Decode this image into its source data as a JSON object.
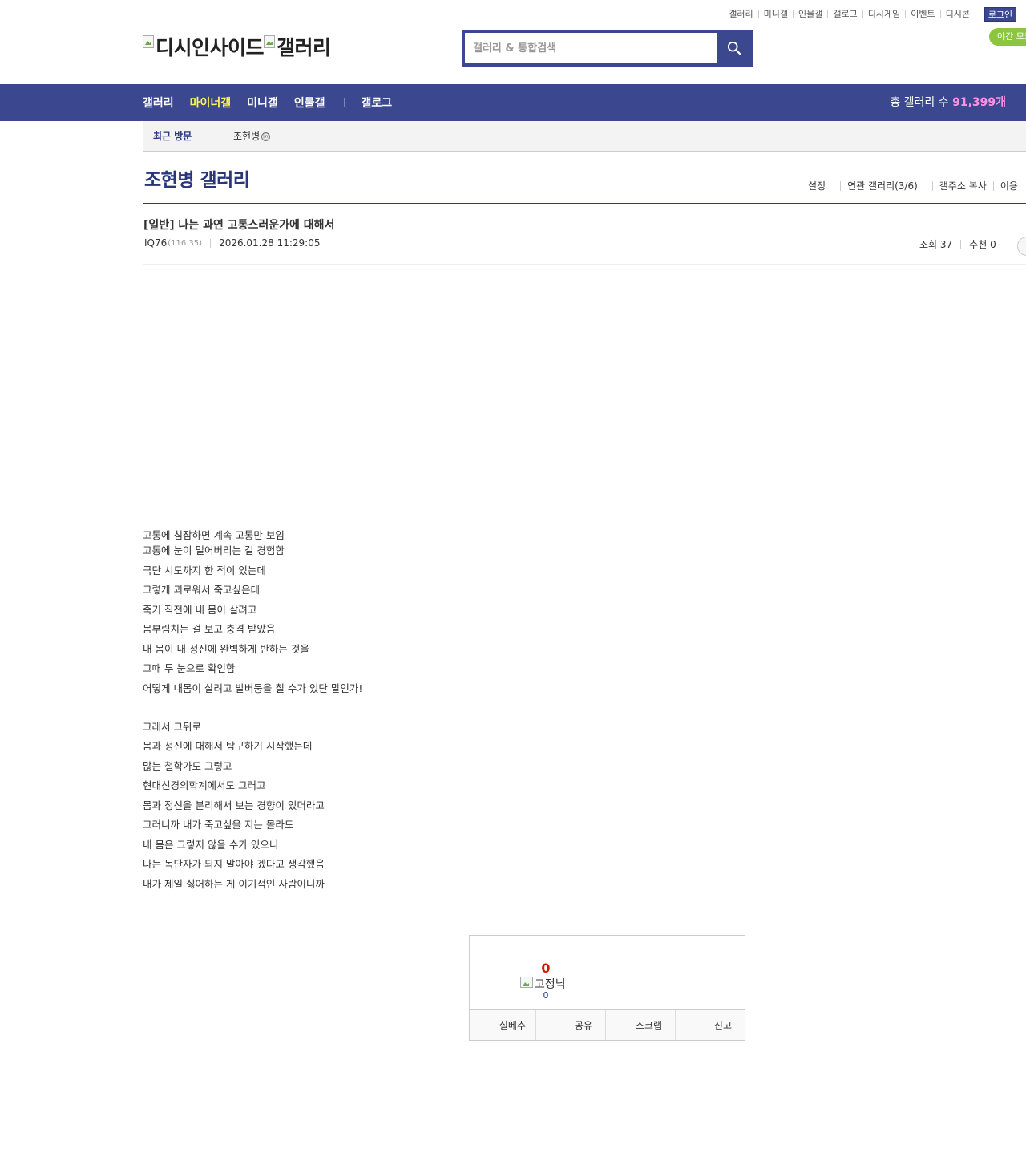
{
  "top_util": {
    "links": [
      "갤러리",
      "미니갤",
      "인물갤",
      "갤로그",
      "디시게임",
      "이벤트",
      "디시콘"
    ],
    "login": "로그인",
    "night_mode": "야간 모드"
  },
  "logo": {
    "site_alt": "디시인사이드",
    "gallery_alt": "갤러리"
  },
  "search": {
    "placeholder": "갤러리 & 통합검색"
  },
  "nav": {
    "items": [
      "갤러리",
      "마이너갤",
      "미니갤",
      "인물갤"
    ],
    "gallog": "갤로그",
    "count_label": "총 갤러리 수 ",
    "count_value": "91,399개"
  },
  "recent": {
    "label": "최근 방문",
    "items": [
      "조현병"
    ],
    "minor_icon": "ⓜ"
  },
  "gallery": {
    "title": "조현병 갤러리",
    "links": [
      "설정",
      "연관 갤러리(3/6)",
      "갤주소 복사",
      "이용"
    ]
  },
  "post": {
    "title": "[일반] 나는 과연 고통스러운가에 대해서",
    "author": "IQ76",
    "author_ip": "(116.35)",
    "date": "2026.01.28 11:29:05",
    "views": "조회 37",
    "recommends": "추천 0"
  },
  "body": {
    "lines_a": [
      "고통에 침잠하면 계속 고통만 보임",
      "고통에 눈이 멀어버리는 걸 경험함",
      "극단 시도까지 한 적이 있는데",
      "그렇게 괴로워서 죽고싶은데",
      "죽기 직전에 내 몸이 살려고",
      "몸부림치는 걸 보고 충격 받았음",
      "내 몸이 내 정신에 완벽하게 반하는 것을",
      "그때 두 눈으로 확인함",
      "어떻게 내몸이 살려고 발버둥을 칠 수가 있단 말인가!"
    ],
    "lines_b": [
      "그래서 그뒤로",
      "몸과 정신에 대해서 탐구하기 시작했는데",
      "많는 철학가도 그렇고",
      "현대신경의학계에서도 그러고",
      "몸과 정신을 분리해서 보는 경향이 있더라고",
      "그러니까 내가 죽고싶을 지는 몰라도",
      "내 몸은 그렇지 않을 수가 있으니",
      "나는 독단자가 되지 말아야 겠다고 생각했음",
      "내가 제일 싫어하는 게 이기적인 사람이니까"
    ]
  },
  "recommend": {
    "count": "0",
    "fixed_alt": "고정닉",
    "fixed_count": "0",
    "actions": [
      "실베추",
      "공유",
      "스크랩",
      "신고"
    ]
  },
  "colors": {
    "brand": "#3b4890",
    "brand_dark": "#29367c",
    "nav_active": "#fef84d",
    "count_highlight": "#fd91e3",
    "recommend_red": "#d31900",
    "night_green": "#8cc63f"
  }
}
